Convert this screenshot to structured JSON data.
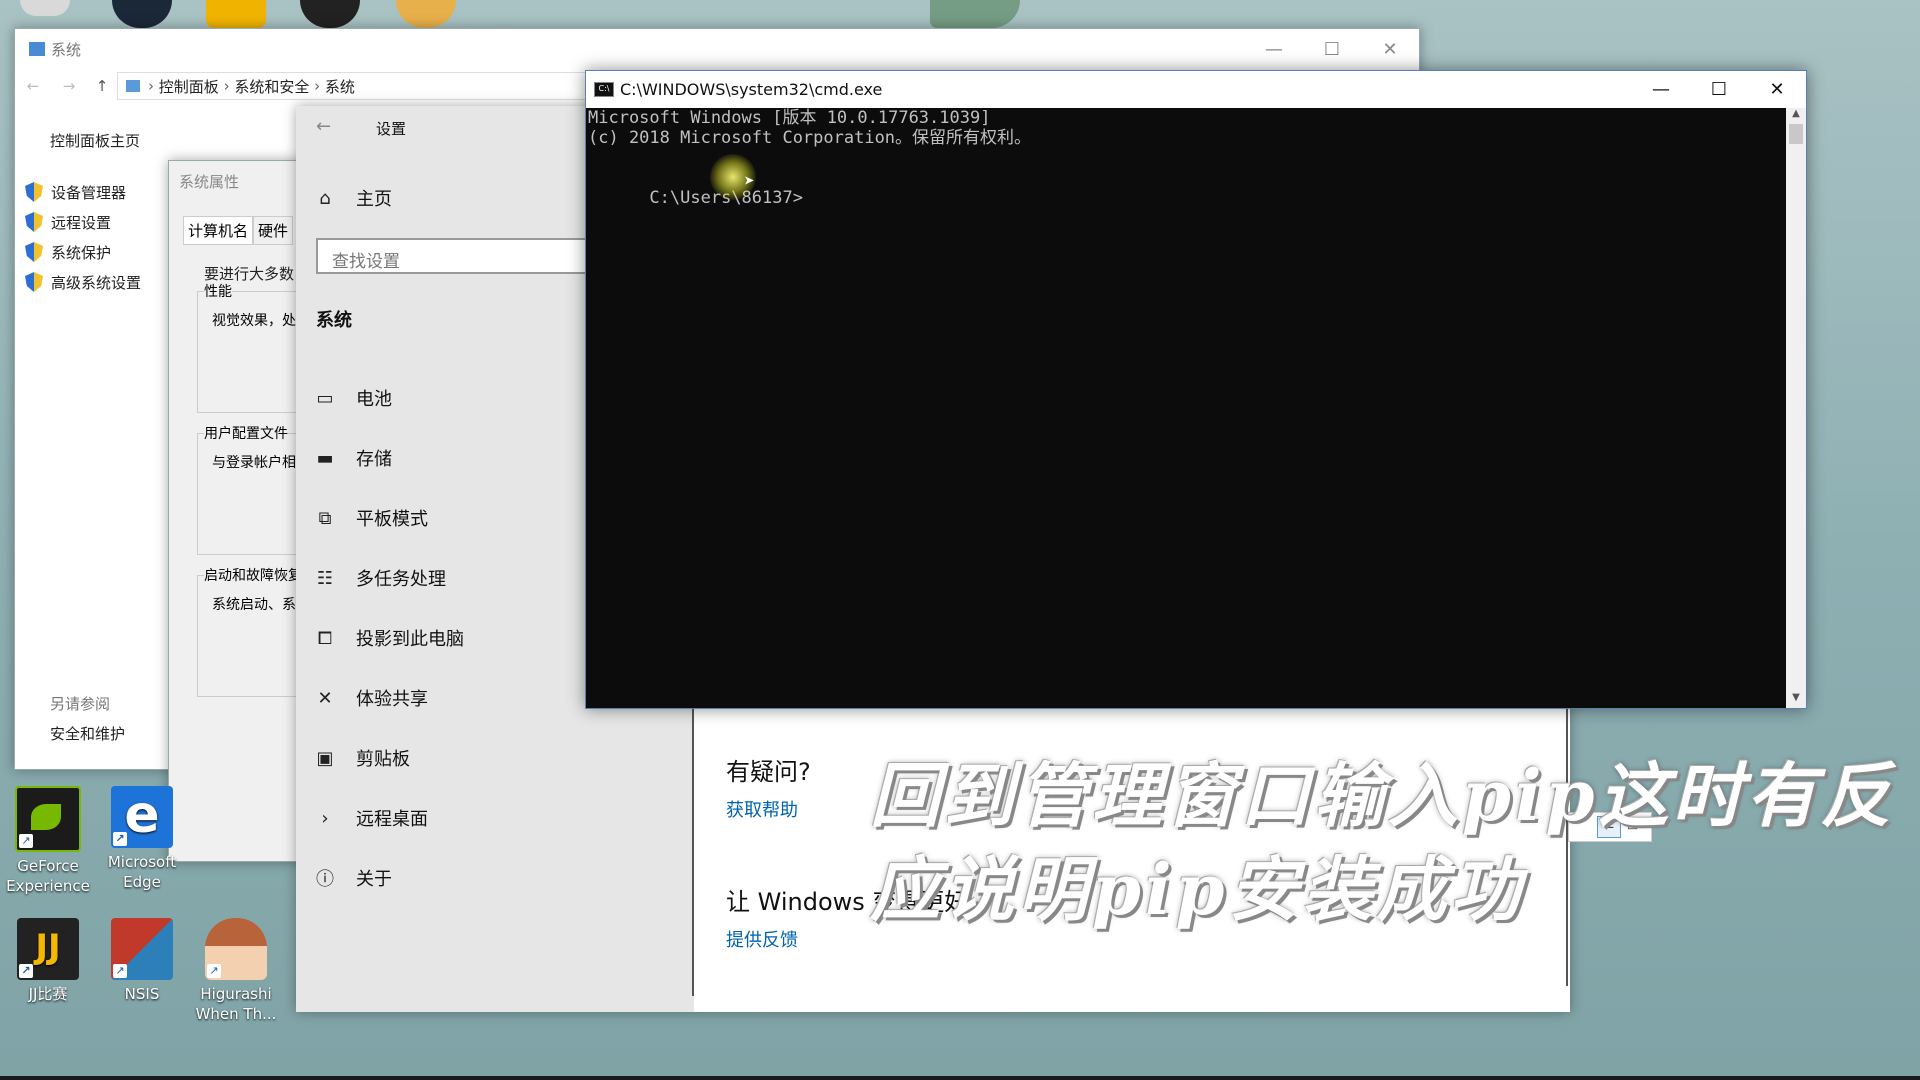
{
  "desktop": {
    "icons": [
      {
        "name": "geforce",
        "label": "GeForce Experience",
        "color": "#76b900"
      },
      {
        "name": "edge",
        "label": "Microsoft Edge",
        "color": "#1e73d8"
      },
      {
        "name": "jj",
        "label": "JJ比赛",
        "color": "#222"
      },
      {
        "name": "nsis",
        "label": "NSIS",
        "color": "#c0392b"
      },
      {
        "name": "higurashi",
        "label": "Higurashi When Th...",
        "color": "#c87a4a"
      }
    ]
  },
  "system_window": {
    "title": "系统",
    "breadcrumb": [
      "控制面板",
      "系统和安全",
      "系统"
    ],
    "home_link": "控制面板主页",
    "links": [
      "设备管理器",
      "远程设置",
      "系统保护",
      "高级系统设置"
    ],
    "see_also_label": "另请参阅",
    "see_also_link": "安全和维护"
  },
  "properties_window": {
    "title": "系统属性",
    "tabs": [
      "计算机名",
      "硬件"
    ],
    "intro": "要进行大多数",
    "groups": [
      {
        "label": "性能",
        "text": "视觉效果，处"
      },
      {
        "label": "用户配置文件",
        "text": "与登录帐户相"
      },
      {
        "label": "启动和故障恢复",
        "text": "系统启动、系"
      }
    ]
  },
  "settings_window": {
    "title": "设置",
    "home": "主页",
    "search_placeholder": "查找设置",
    "section": "系统",
    "nav": [
      {
        "icon": "battery-icon",
        "label": "电池"
      },
      {
        "icon": "storage-icon",
        "label": "存储"
      },
      {
        "icon": "tablet-icon",
        "label": "平板模式"
      },
      {
        "icon": "multitask-icon",
        "label": "多任务处理"
      },
      {
        "icon": "project-icon",
        "label": "投影到此电脑"
      },
      {
        "icon": "share-icon",
        "label": "体验共享"
      },
      {
        "icon": "clipboard-icon",
        "label": "剪贴板"
      },
      {
        "icon": "remote-icon",
        "label": "远程桌面"
      },
      {
        "icon": "info-icon",
        "label": "关于"
      }
    ],
    "question_heading": "有疑问?",
    "get_help": "获取帮助",
    "improve_heading": "让 Windows 变得更好",
    "feedback": "提供反馈"
  },
  "cmd_window": {
    "title": "C:\\WINDOWS\\system32\\cmd.exe",
    "lines": [
      "Microsoft Windows [版本 10.0.17763.1039]",
      "(c) 2018 Microsoft Corporation。保留所有权利。",
      "",
      "C:\\Users\\86137>"
    ]
  },
  "caption": {
    "line1": "回到管理窗口输入pip这时有反",
    "line2": "应说明pip安装成功"
  },
  "colors": {
    "link": "#0063b1",
    "cmd_bg": "#0c0c0c",
    "cmd_text": "#c0c0c0"
  }
}
